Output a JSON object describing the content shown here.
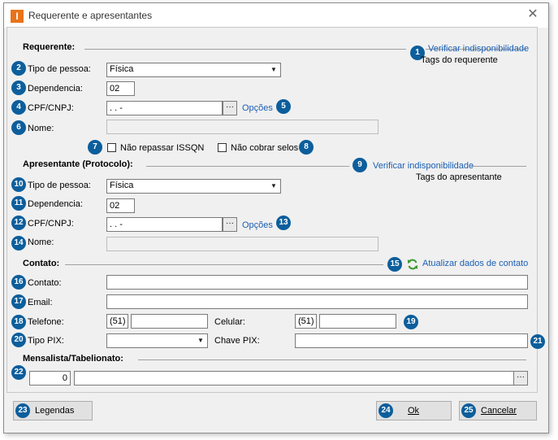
{
  "window": {
    "title": "Requerente e apresentantes",
    "app_icon": "I",
    "close_glyph": "✕"
  },
  "requerente": {
    "section_title": "Requerente:",
    "link_verificar": "Verificar indisponibilidade",
    "tags_text": "Tags do requerente",
    "tipo_pessoa_label": "Tipo de pessoa:",
    "tipo_pessoa_value": "Física",
    "dependencia_label": "Dependencia:",
    "dependencia_value": "02",
    "cpf_label": "CPF/CNPJ:",
    "cpf_value": " .  .  -",
    "opcoes_link": "Opções",
    "nome_label": "Nome:",
    "nome_value": "",
    "chk_issqn": "Não repassar ISSQN",
    "chk_selos": "Não cobrar selos"
  },
  "apresentante": {
    "section_title": "Apresentante (Protocolo):",
    "link_verificar": "Verificar indisponibilidade",
    "tags_text": "Tags do apresentante",
    "tipo_pessoa_label": "Tipo de pessoa:",
    "tipo_pessoa_value": "Física",
    "dependencia_label": "Dependencia:",
    "dependencia_value": "02",
    "cpf_label": "CPF/CNPJ:",
    "cpf_value": " .  .  -",
    "opcoes_link": "Opções",
    "nome_label": "Nome:",
    "nome_value": ""
  },
  "contato": {
    "section_title": "Contato:",
    "atualizar_link": "Atualizar dados de contato",
    "contato_label": "Contato:",
    "contato_value": "",
    "email_label": "Email:",
    "email_value": "",
    "telefone_label": "Telefone:",
    "telefone_ddd": "(51)",
    "telefone_value": "",
    "celular_label": "Celular:",
    "celular_ddd": "(51)",
    "celular_value": "",
    "tipo_pix_label": "Tipo PIX:",
    "tipo_pix_value": "",
    "chave_pix_label": "Chave PIX:",
    "chave_pix_value": ""
  },
  "mensalista": {
    "section_title": "Mensalista/Tabelionato:",
    "code_value": "0",
    "name_value": ""
  },
  "buttons": {
    "legendas": "Legendas",
    "ok": "Ok",
    "cancelar": "Cancelar"
  },
  "badges": [
    "1",
    "2",
    "3",
    "4",
    "5",
    "6",
    "7",
    "8",
    "9",
    "10",
    "11",
    "12",
    "13",
    "14",
    "15",
    "16",
    "17",
    "18",
    "19",
    "20",
    "21",
    "22",
    "23",
    "24",
    "25"
  ],
  "colors": {
    "badge": "#0c5e9c",
    "link": "#1a5fb4",
    "app_icon": "#e8731a"
  }
}
